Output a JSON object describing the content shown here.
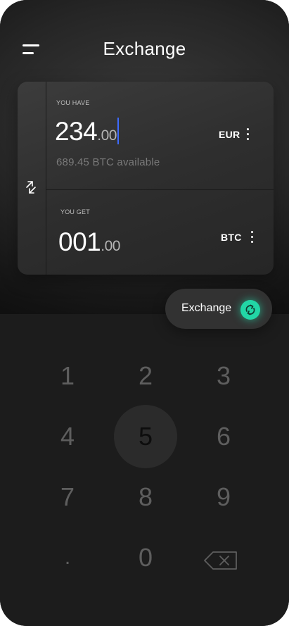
{
  "header": {
    "title": "Exchange",
    "menu_icon": "hamburger-menu-icon"
  },
  "card": {
    "have": {
      "label": "YOU HAVE",
      "amount_int": "234",
      "amount_dec": ".00",
      "currency": "EUR",
      "available": "689.45 BTC available"
    },
    "get": {
      "label": "YOU GET",
      "amount_int": "001",
      "amount_dec": ".00",
      "currency": "BTC"
    },
    "swap_icon": "swap-arrows-icon"
  },
  "exchange_button": {
    "label": "Exchange",
    "icon": "exchange-cycle-icon",
    "accent": "#22d6a6"
  },
  "keypad": {
    "keys": [
      "1",
      "2",
      "3",
      "4",
      "5",
      "6",
      "7",
      "8",
      "9",
      ".",
      "0"
    ],
    "active_key": "5",
    "backspace_icon": "backspace-icon"
  },
  "colors": {
    "background": "#1b1b1b",
    "caret": "#3d6bff",
    "accent": "#22d6a6"
  }
}
